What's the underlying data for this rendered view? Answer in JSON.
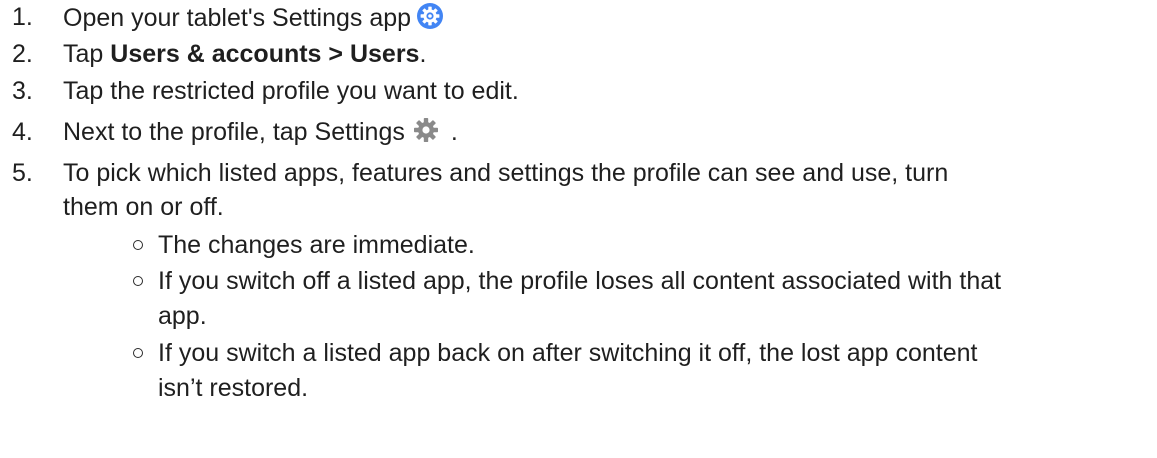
{
  "steps": [
    {
      "number": "1.",
      "text": "Open your tablet's Settings app",
      "icon": "settings-gear-blue-icon"
    },
    {
      "number": "2.",
      "prefix": "Tap ",
      "bold": "Users & accounts > Users",
      "suffix": "."
    },
    {
      "number": "3.",
      "text": "Tap the restricted profile you want to edit."
    },
    {
      "number": "4.",
      "text": "Next to the profile, tap Settings",
      "icon": "settings-gear-gray-icon",
      "suffix": "."
    },
    {
      "number": "5.",
      "line1": "To pick which listed apps, features and settings the profile can see and use, turn",
      "line2": "them on or off."
    }
  ],
  "sub_bullets": [
    {
      "line1": "The changes are immediate."
    },
    {
      "line1": "If you switch off a listed app, the profile loses all content associated with that",
      "line2": "app."
    },
    {
      "line1": "If you switch a listed app back on after switching it off, the lost app content",
      "line2": "isn’t restored."
    }
  ],
  "colors": {
    "text": "#1f1f1f",
    "gear_blue": "#4285f4",
    "gear_gray": "#8a8a8a"
  }
}
